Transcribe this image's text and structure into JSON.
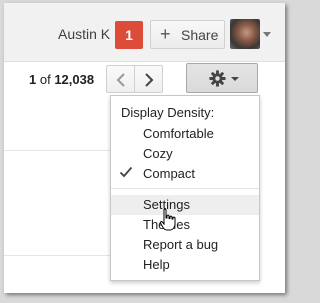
{
  "header": {
    "user_name": "Austin K",
    "notification_count": "1",
    "share_label": "Share",
    "share_icon": "plus-icon",
    "avatar": "user-avatar-photo"
  },
  "toolbar": {
    "pager_start": "1",
    "pager_of": " of ",
    "pager_total": "12,038",
    "prev_icon": "chevron-left-icon",
    "next_icon": "chevron-right-icon",
    "settings_icon": "gear-icon"
  },
  "menu": {
    "heading": "Display Density:",
    "density_options": [
      {
        "label": "Comfortable",
        "checked": false
      },
      {
        "label": "Cozy",
        "checked": false
      },
      {
        "label": "Compact",
        "checked": true
      }
    ],
    "items": [
      {
        "label": "Settings",
        "hovered": true
      },
      {
        "label": "Themes",
        "hovered": false
      },
      {
        "label": "Report a bug",
        "hovered": false
      },
      {
        "label": "Help",
        "hovered": false
      }
    ]
  },
  "colors": {
    "notification_badge": "#dd4b39",
    "menu_hover": "#eeeeee"
  }
}
